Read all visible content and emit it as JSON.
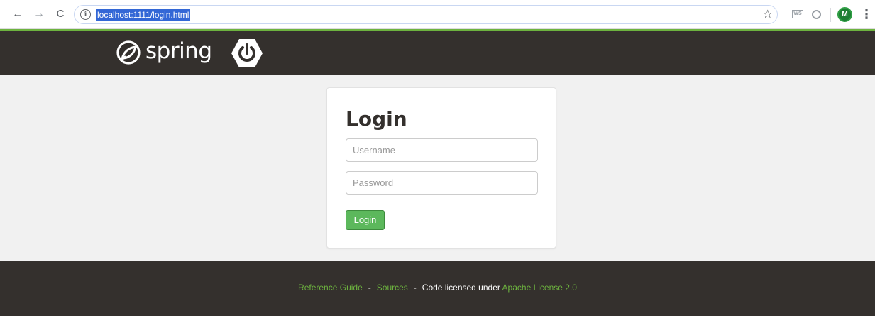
{
  "browser": {
    "url": "localhost:1111/login.html",
    "back_glyph": "←",
    "forward_glyph": "→",
    "reload_glyph": "C",
    "info_glyph": "i",
    "star_glyph": "☆",
    "ext_ws_label": "WS",
    "avatar_initial": "M",
    "menu_glyph": "⋮",
    "icons": [
      "back-arrow-icon",
      "forward-arrow-icon",
      "reload-icon",
      "info-icon",
      "bookmark-star-icon",
      "ws-extension-icon",
      "circle-extension-icon",
      "avatar",
      "kebab-menu-icon"
    ]
  },
  "header": {
    "logo_text": "spring",
    "background": "#34302d",
    "accent": "#6db33f",
    "icons": [
      "spring-leaf-icon",
      "spring-boot-power-icon"
    ]
  },
  "login": {
    "title": "Login",
    "username_placeholder": "Username",
    "username_value": "",
    "password_placeholder": "Password",
    "password_value": "",
    "button_label": "Login",
    "button_color": "#5cb85c"
  },
  "footer": {
    "reference_guide": "Reference Guide",
    "separator": "-",
    "sources": "Sources",
    "licensed_text": "Code licensed under",
    "license_link": "Apache License 2.0",
    "link_color": "#6db33f"
  }
}
